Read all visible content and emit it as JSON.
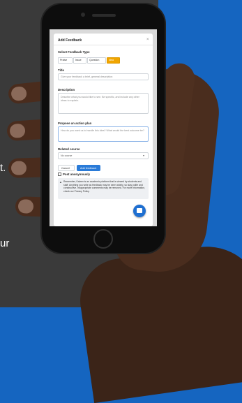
{
  "page_text": {
    "line1": "t.",
    "line2": "ur"
  },
  "modal": {
    "title": "Add Feedback",
    "close": "×",
    "type_label": "Select Feedback Type",
    "types": [
      "Praise",
      "Issue",
      "Question",
      "Idea"
    ],
    "active_type": "Idea",
    "title_label": "Title",
    "title_placeholder": "Give your feedback a brief, general description",
    "description_label": "Description",
    "description_placeholder": "Describe what you would like to see. Be specific, and include any other ideas to explain.",
    "action_label": "Propose an action plan",
    "action_placeholder": "How do you want us to handle this idea? What would the best outcome be?",
    "course_label": "Related course",
    "course_value": "No course",
    "anon_label": "Post anonymously",
    "cancel": "Cancel",
    "submit": "Add feedback",
    "notice": "Remember, Kaizen is an academic platform that is viewed by students and staff. Anything you write as feedback may be seen widely, so stay polite and constructive. Inappropriate comments may be removed. For more information, check our Privacy Policy."
  },
  "colors": {
    "accent": "#2a7bd8",
    "active_type": "#f0a500",
    "background_blue": "#1565c0",
    "background_dark": "#3a3a3a"
  },
  "icons": {
    "help_fab": "chat-icon"
  }
}
